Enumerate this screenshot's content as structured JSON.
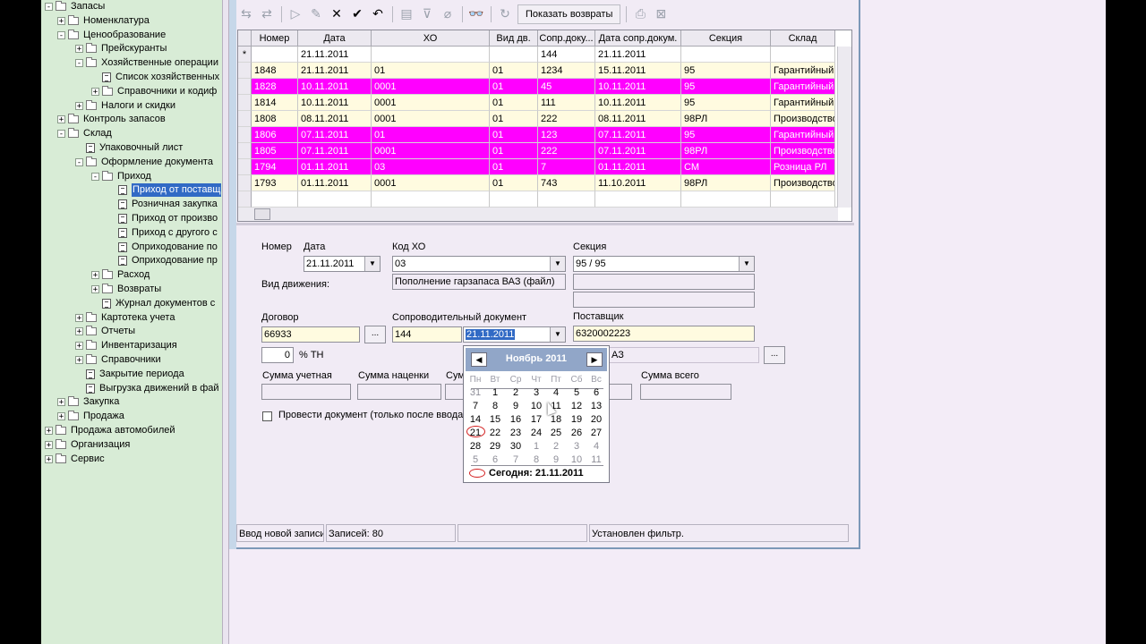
{
  "tree": {
    "items": [
      {
        "label": "Запасы",
        "level": 0,
        "exp": "-",
        "icon": "folder"
      },
      {
        "label": "Номенклатура",
        "level": 1,
        "exp": "+",
        "icon": "folder"
      },
      {
        "label": "Ценообразование",
        "level": 1,
        "exp": "-",
        "icon": "folder"
      },
      {
        "label": "Прейскуранты",
        "level": 2,
        "exp": "+",
        "icon": "folder"
      },
      {
        "label": "Хозяйственные операции",
        "level": 2,
        "exp": "-",
        "icon": "folder"
      },
      {
        "label": "Список хозяйственных",
        "level": 3,
        "exp": "",
        "icon": "doc"
      },
      {
        "label": "Справочники  и кодиф",
        "level": 3,
        "exp": "+",
        "icon": "folder"
      },
      {
        "label": "Налоги и скидки",
        "level": 2,
        "exp": "+",
        "icon": "folder"
      },
      {
        "label": "Контроль запасов",
        "level": 1,
        "exp": "+",
        "icon": "folder"
      },
      {
        "label": "Склад",
        "level": 1,
        "exp": "-",
        "icon": "folder"
      },
      {
        "label": "Упаковочный лист",
        "level": 2,
        "exp": "",
        "icon": "doc"
      },
      {
        "label": "Оформление документа",
        "level": 2,
        "exp": "-",
        "icon": "folder"
      },
      {
        "label": "Приход",
        "level": 3,
        "exp": "-",
        "icon": "folder"
      },
      {
        "label": "Приход от поставщ",
        "level": 4,
        "exp": "",
        "icon": "doc",
        "selected": true
      },
      {
        "label": "Розничная закупка",
        "level": 4,
        "exp": "",
        "icon": "doc"
      },
      {
        "label": "Приход от произво",
        "level": 4,
        "exp": "",
        "icon": "doc"
      },
      {
        "label": "Приход с другого с",
        "level": 4,
        "exp": "",
        "icon": "doc"
      },
      {
        "label": "Оприходование по",
        "level": 4,
        "exp": "",
        "icon": "doc"
      },
      {
        "label": "Оприходование пр",
        "level": 4,
        "exp": "",
        "icon": "doc"
      },
      {
        "label": "Расход",
        "level": 3,
        "exp": "+",
        "icon": "folder"
      },
      {
        "label": "Возвраты",
        "level": 3,
        "exp": "+",
        "icon": "folder"
      },
      {
        "label": "Журнал документов с",
        "level": 3,
        "exp": "",
        "icon": "doc"
      },
      {
        "label": "Картотека учета",
        "level": 2,
        "exp": "+",
        "icon": "folder"
      },
      {
        "label": "Отчеты",
        "level": 2,
        "exp": "+",
        "icon": "folder"
      },
      {
        "label": "Инвентаризация",
        "level": 2,
        "exp": "+",
        "icon": "folder"
      },
      {
        "label": "Справочники",
        "level": 2,
        "exp": "+",
        "icon": "folder"
      },
      {
        "label": "Закрытие периода",
        "level": 2,
        "exp": "",
        "icon": "doc"
      },
      {
        "label": "Выгрузка движений в фай",
        "level": 2,
        "exp": "",
        "icon": "doc"
      },
      {
        "label": "Закупка",
        "level": 1,
        "exp": "+",
        "icon": "folder"
      },
      {
        "label": "Продажа",
        "level": 1,
        "exp": "+",
        "icon": "folder"
      },
      {
        "label": "Продажа автомобилей",
        "level": 0,
        "exp": "+",
        "icon": "folder"
      },
      {
        "label": "Организация",
        "level": 0,
        "exp": "+",
        "icon": "folder"
      },
      {
        "label": "Сервис",
        "level": 0,
        "exp": "+",
        "icon": "folder"
      }
    ]
  },
  "toolbar": {
    "show_returns": "Показать возвраты"
  },
  "grid": {
    "columns": [
      "Номер",
      "Дата",
      "ХО",
      "Вид дв.",
      "Сопр.доку...",
      "Дата сопр.докум.",
      "Секция",
      "Склад"
    ],
    "rows": [
      {
        "style": "white",
        "mark": "*",
        "cells": [
          "",
          "21.11.2011",
          "",
          "",
          "144",
          "21.11.2011",
          "",
          ""
        ]
      },
      {
        "style": "cream",
        "mark": "",
        "cells": [
          "1848",
          "21.11.2011",
          "01",
          "01",
          "1234",
          "15.11.2011",
          "95",
          "Гарантийный"
        ]
      },
      {
        "style": "magenta",
        "mark": "",
        "cells": [
          "1828",
          "10.11.2011",
          "0001",
          "01",
          "45",
          "10.11.2011",
          "95",
          "Гарантийный"
        ]
      },
      {
        "style": "cream",
        "mark": "",
        "cells": [
          "1814",
          "10.11.2011",
          "0001",
          "01",
          "111",
          "10.11.2011",
          "95",
          "Гарантийный"
        ]
      },
      {
        "style": "cream",
        "mark": "",
        "cells": [
          "1808",
          "08.11.2011",
          "0001",
          "01",
          "222",
          "08.11.2011",
          "98РЛ",
          "Производство"
        ]
      },
      {
        "style": "magenta",
        "mark": "",
        "cells": [
          "1806",
          "07.11.2011",
          "01",
          "01",
          "123",
          "07.11.2011",
          "95",
          "Гарантийный"
        ]
      },
      {
        "style": "magenta",
        "mark": "",
        "cells": [
          "1805",
          "07.11.2011",
          "0001",
          "01",
          "222",
          "07.11.2011",
          "98РЛ",
          "Производство"
        ]
      },
      {
        "style": "magenta",
        "mark": "",
        "cells": [
          "1794",
          "01.11.2011",
          "03",
          "01",
          "7",
          "01.11.2011",
          "СМ",
          "Розница РЛ"
        ]
      },
      {
        "style": "cream",
        "mark": "",
        "cells": [
          "1793",
          "01.11.2011",
          "0001",
          "01",
          "743",
          "11.10.2011",
          "98РЛ",
          "Производство"
        ]
      },
      {
        "style": "white",
        "mark": "",
        "cells": [
          "",
          "",
          "",
          "",
          "",
          "",
          "",
          ""
        ]
      }
    ]
  },
  "form": {
    "nomer_label": "Номер",
    "data_label": "Дата",
    "data_value": "21.11.2011",
    "kod_ho_label": "Код ХО",
    "kod_ho_value": "03",
    "kod_ho_desc": "Пополнение гарзапаса ВАЗ (файл)",
    "sekciya_label": "Секция",
    "sekciya_value": "95    / 95",
    "vid_dvizh_label": "Вид движения:",
    "dogovor_label": "Договор",
    "dogovor_value": "66933",
    "soprov_label": "Сопроводительный документ",
    "soprov_num": "144",
    "soprov_date": "21.11.2011",
    "postavshik_label": "Поставщик",
    "postavshik_value": "6320002223",
    "postavshik_tail": "АЗ",
    "percent_value": "0",
    "percent_label": "% ТН",
    "summa_uchet_label": "Сумма учетная",
    "summa_nacenki_label": "Сумма наценки",
    "summa_cut_label": "Сум",
    "summa_vsego_label": "Сумма всего",
    "provesti_label": "Провести документ (только после ввода"
  },
  "calendar": {
    "title": "Ноябрь 2011",
    "dow": [
      "Пн",
      "Вт",
      "Ср",
      "Чт",
      "Пт",
      "Сб",
      "Вс"
    ],
    "weeks": [
      [
        "31",
        "1",
        "2",
        "3",
        "4",
        "5",
        "6"
      ],
      [
        "7",
        "8",
        "9",
        "10",
        "11",
        "12",
        "13"
      ],
      [
        "14",
        "15",
        "16",
        "17",
        "18",
        "19",
        "20"
      ],
      [
        "21",
        "22",
        "23",
        "24",
        "25",
        "26",
        "27"
      ],
      [
        "28",
        "29",
        "30",
        "1",
        "2",
        "3",
        "4"
      ],
      [
        "5",
        "6",
        "7",
        "8",
        "9",
        "10",
        "11"
      ]
    ],
    "today_label": "Сегодня: 21.11.2011"
  },
  "status": {
    "mode": "Ввод новой записи",
    "records": "Записей: 80",
    "empty": "",
    "filter": "Установлен фильтр."
  },
  "colors": {
    "tree_bg": "#d8ecd6",
    "magenta_row": "#ff00ff",
    "cream_row": "#fffbe0",
    "selection": "#316ac5"
  }
}
